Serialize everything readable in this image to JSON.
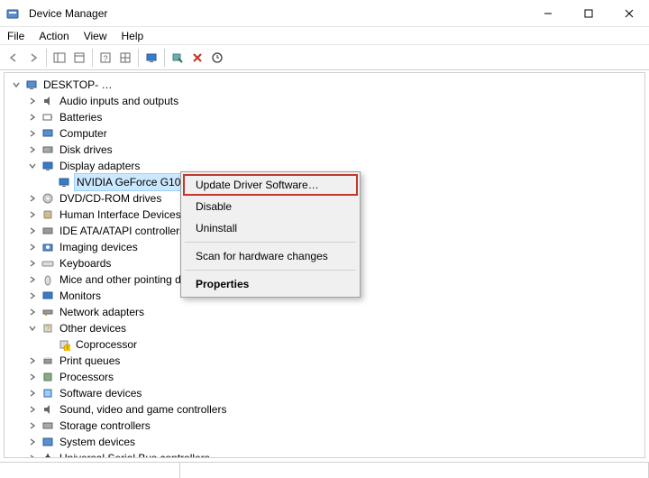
{
  "title": "Device Manager",
  "menu": {
    "file": "File",
    "action": "Action",
    "view": "View",
    "help": "Help"
  },
  "tree": {
    "root": "DESKTOP-  …",
    "items": [
      "Audio inputs and outputs",
      "Batteries",
      "Computer",
      "Disk drives",
      "Display adapters",
      "DVD/CD-ROM drives",
      "Human Interface Devices",
      "IDE ATA/ATAPI controllers",
      "Imaging devices",
      "Keyboards",
      "Mice and other pointing devices",
      "Monitors",
      "Network adapters",
      "Other devices",
      "Print queues",
      "Processors",
      "Software devices",
      "Sound, video and game controllers",
      "Storage controllers",
      "System devices",
      "Universal Serial Bus controllers"
    ],
    "display_child": "NVIDIA GeForce G102M",
    "other_child": "Coprocessor"
  },
  "context": {
    "update": "Update Driver Software…",
    "disable": "Disable",
    "uninstall": "Uninstall",
    "scan": "Scan for hardware changes",
    "properties": "Properties"
  }
}
